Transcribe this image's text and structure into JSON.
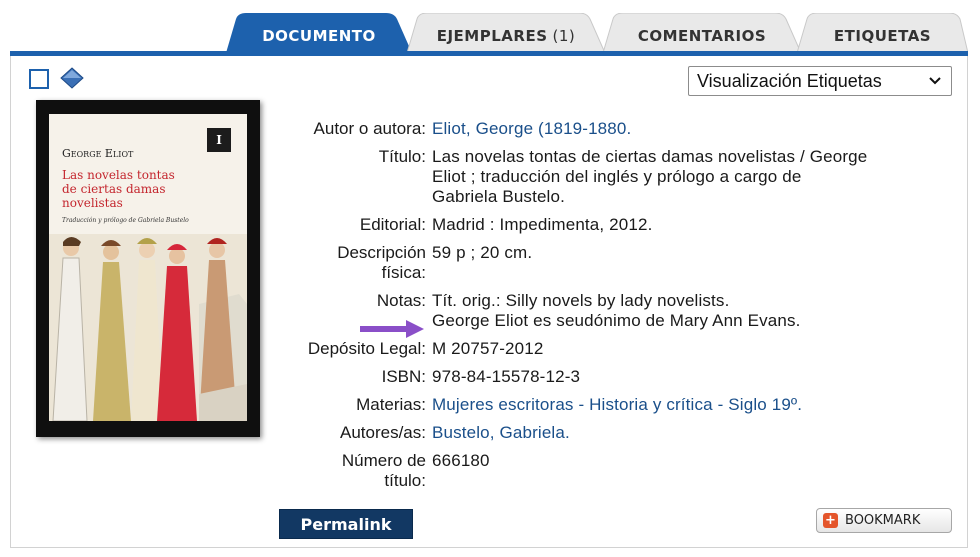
{
  "tabs": [
    {
      "label": "DOCUMENTO",
      "count": "",
      "active": true
    },
    {
      "label": "EJEMPLARES",
      "count": "(1)",
      "active": false
    },
    {
      "label": "COMENTARIOS",
      "count": "",
      "active": false
    },
    {
      "label": "ETIQUETAS",
      "count": "",
      "active": false
    }
  ],
  "view_select": {
    "selected": "Visualización Etiquetas"
  },
  "cover": {
    "author": "George Eliot",
    "title_line1": "Las novelas tontas",
    "title_line2": "de ciertas damas novelistas",
    "subtitle": "Traducción y prólogo de Gabriela Bustelo",
    "publisher_mark": "I"
  },
  "record": {
    "author_label": "Autor o autora:",
    "author_value": "Eliot, George (1819-1880.",
    "title_label": "Título:",
    "title_line1": "Las novelas tontas de ciertas damas novelistas / George",
    "title_line2": "Eliot ; traducción del inglés y prólogo a cargo de",
    "title_line3": "Gabriela Bustelo.",
    "publisher_label": "Editorial:",
    "publisher_value": "Madrid : Impedimenta, 2012.",
    "description_label_line1": "Descripción",
    "description_label_line2": "física:",
    "description_value": "59 p ; 20 cm.",
    "notes_label": "Notas:",
    "notes_line1": "Tít. orig.: Silly novels by lady novelists.",
    "notes_line2": "George Eliot es seudónimo de Mary Ann Evans.",
    "legal_deposit_label": "Depósito Legal:",
    "legal_deposit_value": "M 20757-2012",
    "isbn_label": "ISBN:",
    "isbn_value": "978-84-15578-12-3",
    "subjects_label": "Materias:",
    "subjects_value": "Mujeres escritoras - Historia y crítica - Siglo 19º.",
    "authors_label": "Autores/as:",
    "authors_value": "Bustelo, Gabriela.",
    "title_number_label_line1": "Número de",
    "title_number_label_line2": "título:",
    "title_number_value": "666180"
  },
  "actions": {
    "permalink": "Permalink",
    "bookmark": "BOOKMARK"
  },
  "colors": {
    "tab_active": "#1d61ad",
    "tab_inactive": "#e9e9e9",
    "link": "#1a4f8a",
    "permalink_bg": "#123863",
    "arrow": "#8a4fc8"
  }
}
